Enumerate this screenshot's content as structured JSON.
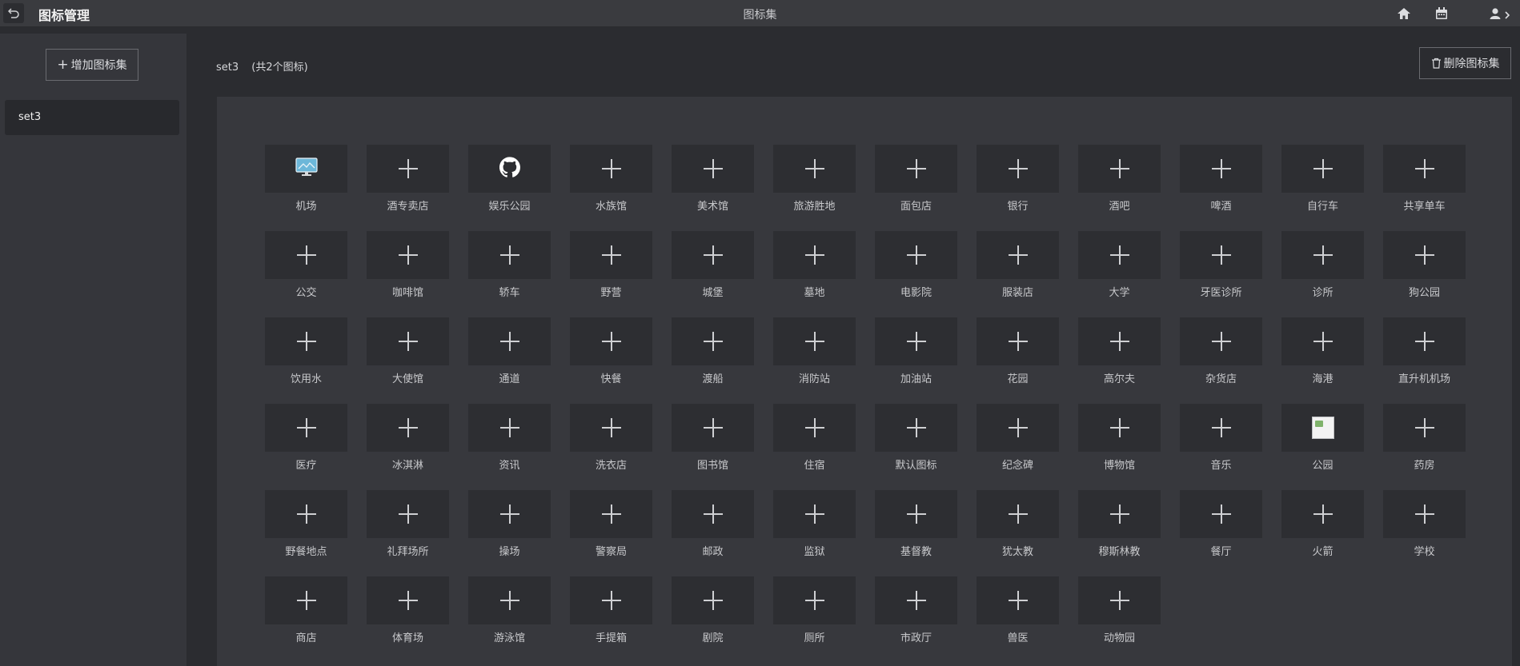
{
  "header": {
    "app_title": "图标管理",
    "center_title": "图标集"
  },
  "sidebar": {
    "add_set_label": "增加图标集",
    "sets": [
      {
        "label": "set3",
        "selected": true
      }
    ]
  },
  "main": {
    "set_name": "set3",
    "icon_count_text": "(共2个图标)",
    "delete_set_label": "删除图标集"
  },
  "icons": [
    {
      "label": "机场",
      "icon": "monitor-image"
    },
    {
      "label": "酒专卖店",
      "icon": "plus"
    },
    {
      "label": "娱乐公园",
      "icon": "github"
    },
    {
      "label": "水族馆",
      "icon": "plus"
    },
    {
      "label": "美术馆",
      "icon": "plus"
    },
    {
      "label": "旅游胜地",
      "icon": "plus"
    },
    {
      "label": "面包店",
      "icon": "plus"
    },
    {
      "label": "银行",
      "icon": "plus"
    },
    {
      "label": "酒吧",
      "icon": "plus"
    },
    {
      "label": "啤酒",
      "icon": "plus"
    },
    {
      "label": "自行车",
      "icon": "plus"
    },
    {
      "label": "共享单车",
      "icon": "plus"
    },
    {
      "label": "公交",
      "icon": "plus"
    },
    {
      "label": "咖啡馆",
      "icon": "plus"
    },
    {
      "label": "轿车",
      "icon": "plus"
    },
    {
      "label": "野营",
      "icon": "plus"
    },
    {
      "label": "城堡",
      "icon": "plus"
    },
    {
      "label": "墓地",
      "icon": "plus"
    },
    {
      "label": "电影院",
      "icon": "plus"
    },
    {
      "label": "服装店",
      "icon": "plus"
    },
    {
      "label": "大学",
      "icon": "plus"
    },
    {
      "label": "牙医诊所",
      "icon": "plus"
    },
    {
      "label": "诊所",
      "icon": "plus"
    },
    {
      "label": "狗公园",
      "icon": "plus"
    },
    {
      "label": "饮用水",
      "icon": "plus"
    },
    {
      "label": "大使馆",
      "icon": "plus"
    },
    {
      "label": "通道",
      "icon": "plus"
    },
    {
      "label": "快餐",
      "icon": "plus"
    },
    {
      "label": "渡船",
      "icon": "plus"
    },
    {
      "label": "消防站",
      "icon": "plus"
    },
    {
      "label": "加油站",
      "icon": "plus"
    },
    {
      "label": "花园",
      "icon": "plus"
    },
    {
      "label": "高尔夫",
      "icon": "plus"
    },
    {
      "label": "杂货店",
      "icon": "plus"
    },
    {
      "label": "海港",
      "icon": "plus"
    },
    {
      "label": "直升机机场",
      "icon": "plus"
    },
    {
      "label": "医疗",
      "icon": "plus"
    },
    {
      "label": "冰淇淋",
      "icon": "plus"
    },
    {
      "label": "资讯",
      "icon": "plus"
    },
    {
      "label": "洗衣店",
      "icon": "plus"
    },
    {
      "label": "图书馆",
      "icon": "plus"
    },
    {
      "label": "住宿",
      "icon": "plus"
    },
    {
      "label": "默认图标",
      "icon": "plus"
    },
    {
      "label": "纪念碑",
      "icon": "plus"
    },
    {
      "label": "博物馆",
      "icon": "plus"
    },
    {
      "label": "音乐",
      "icon": "plus"
    },
    {
      "label": "公园",
      "icon": "broken-image"
    },
    {
      "label": "药房",
      "icon": "plus"
    },
    {
      "label": "野餐地点",
      "icon": "plus"
    },
    {
      "label": "礼拜场所",
      "icon": "plus"
    },
    {
      "label": "操场",
      "icon": "plus"
    },
    {
      "label": "警察局",
      "icon": "plus"
    },
    {
      "label": "邮政",
      "icon": "plus"
    },
    {
      "label": "监狱",
      "icon": "plus"
    },
    {
      "label": "基督教",
      "icon": "plus"
    },
    {
      "label": "犹太教",
      "icon": "plus"
    },
    {
      "label": "穆斯林教",
      "icon": "plus"
    },
    {
      "label": "餐厅",
      "icon": "plus"
    },
    {
      "label": "火箭",
      "icon": "plus"
    },
    {
      "label": "学校",
      "icon": "plus"
    },
    {
      "label": "商店",
      "icon": "plus"
    },
    {
      "label": "体育场",
      "icon": "plus"
    },
    {
      "label": "游泳馆",
      "icon": "plus"
    },
    {
      "label": "手提箱",
      "icon": "plus"
    },
    {
      "label": "剧院",
      "icon": "plus"
    },
    {
      "label": "厕所",
      "icon": "plus"
    },
    {
      "label": "市政厅",
      "icon": "plus"
    },
    {
      "label": "兽医",
      "icon": "plus"
    },
    {
      "label": "动物园",
      "icon": "plus"
    }
  ]
}
